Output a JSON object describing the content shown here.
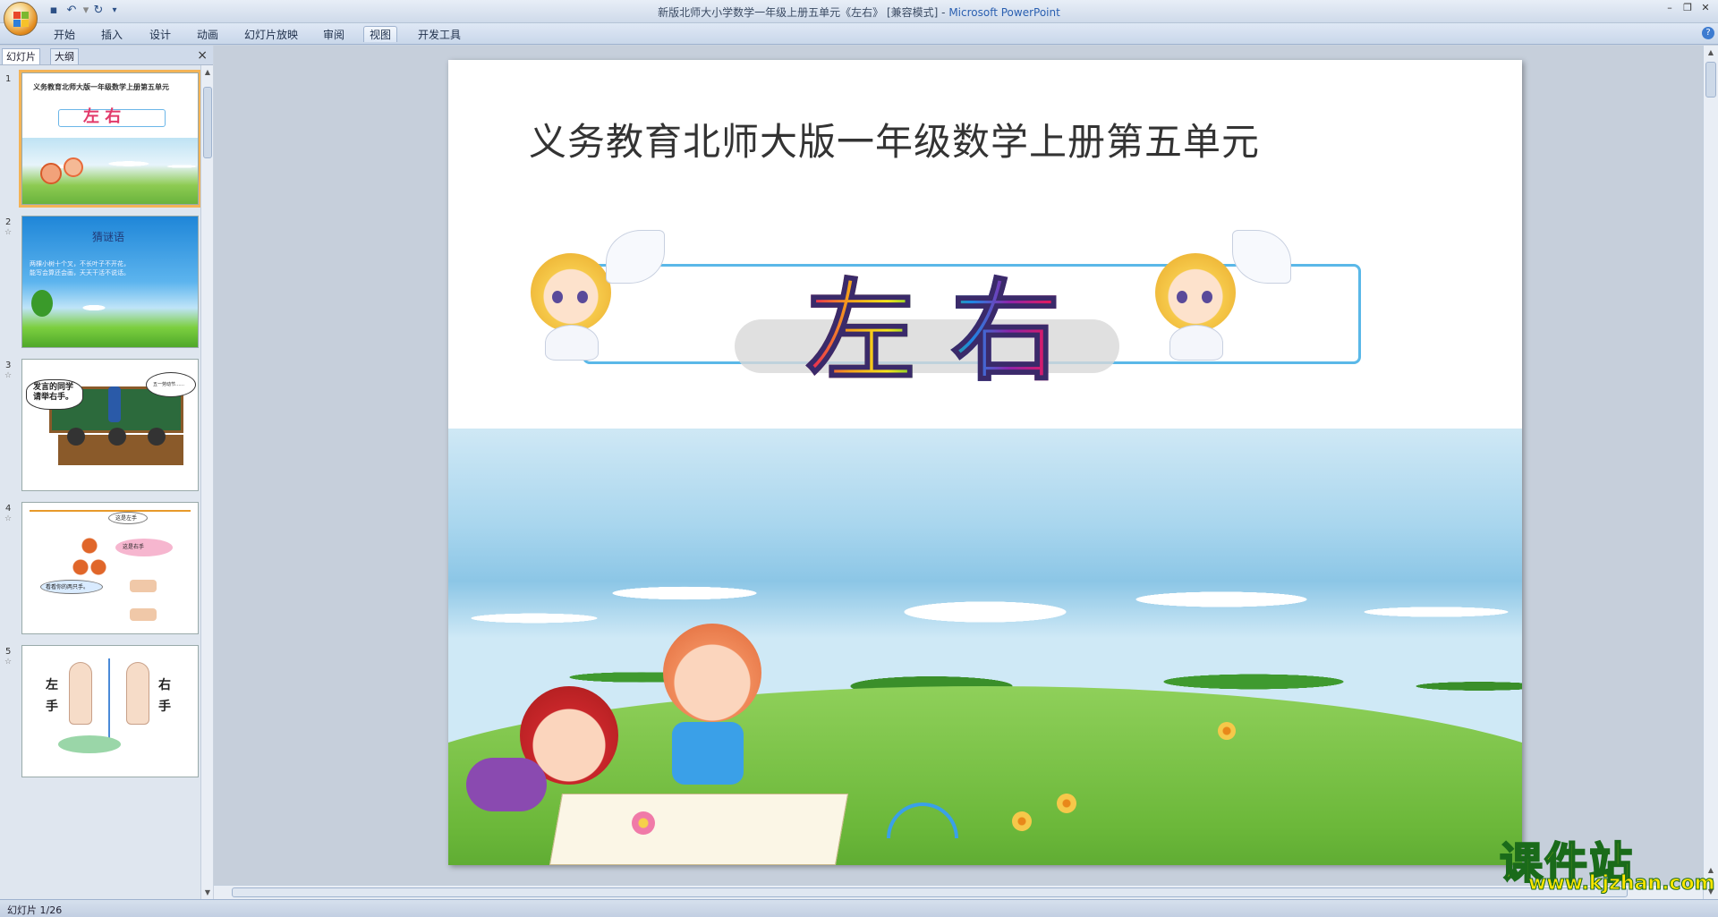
{
  "window": {
    "title": "新版北师大小学数学一年级上册五单元《左右》 [兼容模式] - ",
    "app_name": "Microsoft PowerPoint"
  },
  "ribbon": {
    "tabs": [
      "开始",
      "插入",
      "设计",
      "动画",
      "幻灯片放映",
      "审阅",
      "视图",
      "开发工具"
    ],
    "active_tab": "视图"
  },
  "left_pane": {
    "tabs": [
      "幻灯片",
      "大纲"
    ],
    "close": "×",
    "thumbnails": [
      {
        "number": "1",
        "heading": "义务教育北师大版一年级数学上册第五单元",
        "title_word": "左 右"
      },
      {
        "number": "2",
        "heading": "猜谜语",
        "line1": "两棵小树十个叉，不长叶子不开花，",
        "line2": "能写会算还会画，天天干活不说话。"
      },
      {
        "number": "3",
        "bubble1": "发言的同学请举右手。",
        "bubble2": "五一劳动节……"
      },
      {
        "number": "4",
        "bubble1": "这是左手",
        "bubble2": "这是右手",
        "bubble3": "看看你的两只手。"
      },
      {
        "number": "5",
        "left_label": "左手",
        "right_label": "右手"
      }
    ]
  },
  "slide": {
    "heading": "义务教育北师大版一年级数学上册第五单元",
    "title_word": "左右",
    "sky_color": "#a9d6ee",
    "grass_color": "#7fc24a"
  },
  "status": {
    "slide_indicator": "幻灯片 1/26"
  },
  "watermark": {
    "title": "课件站",
    "url": "www.kjzhan.com"
  }
}
